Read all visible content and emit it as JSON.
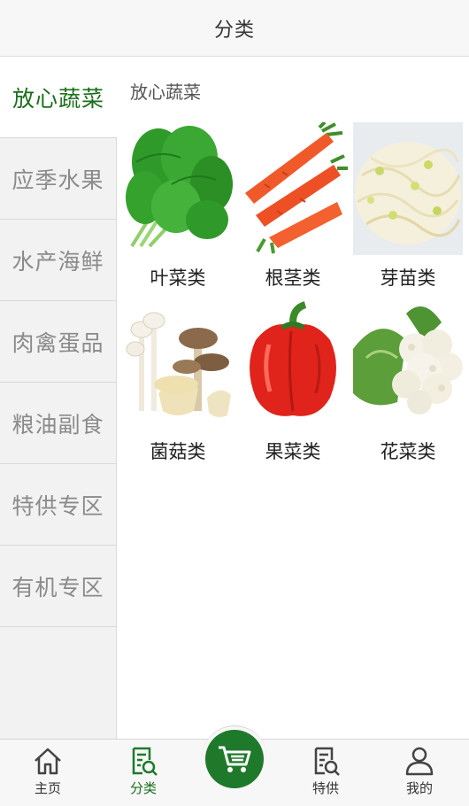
{
  "header": {
    "title": "分类"
  },
  "sidebar": {
    "items": [
      {
        "label": "放心蔬菜",
        "active": true
      },
      {
        "label": "应季水果"
      },
      {
        "label": "水产海鲜"
      },
      {
        "label": "肉禽蛋品"
      },
      {
        "label": "粮油副食"
      },
      {
        "label": "特供专区"
      },
      {
        "label": "有机专区"
      }
    ]
  },
  "main": {
    "section_title": "放心蔬菜",
    "categories": [
      {
        "label": "叶菜类",
        "image": "leafy-greens"
      },
      {
        "label": "根茎类",
        "image": "carrots"
      },
      {
        "label": "芽苗类",
        "image": "bean-sprouts"
      },
      {
        "label": "菌菇类",
        "image": "mushrooms"
      },
      {
        "label": "果菜类",
        "image": "red-bell-pepper"
      },
      {
        "label": "花菜类",
        "image": "cauliflower"
      }
    ]
  },
  "tabbar": {
    "home": {
      "label": "主页",
      "icon": "home-icon"
    },
    "category": {
      "label": "分类",
      "icon": "category-icon",
      "active": true
    },
    "cart": {
      "icon": "cart-icon"
    },
    "special": {
      "label": "特供",
      "icon": "special-icon"
    },
    "mine": {
      "label": "我的",
      "icon": "user-icon"
    }
  },
  "colors": {
    "accent": "#1e7a2a",
    "active_text": "#1a6e1a"
  }
}
